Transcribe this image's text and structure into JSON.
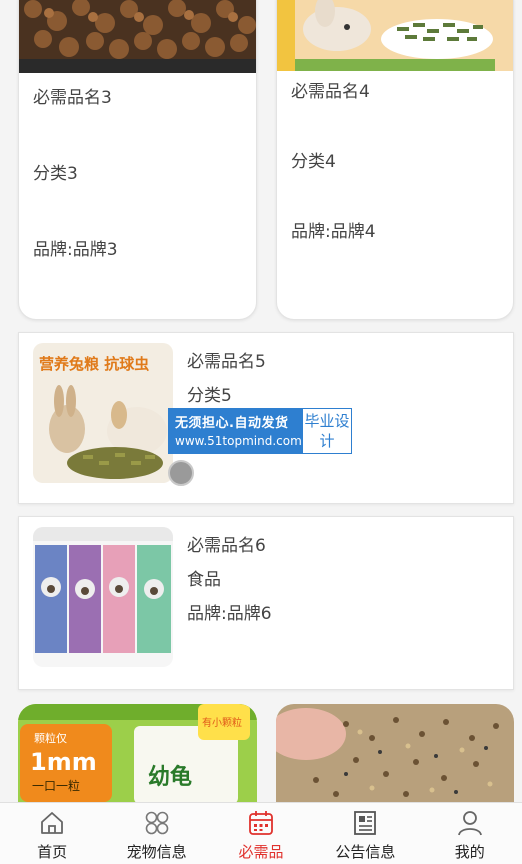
{
  "items": [
    {
      "name": "必需品名3",
      "category": "分类3",
      "brand": "品牌:品牌3"
    },
    {
      "name": "必需品名4",
      "category": "分类4",
      "brand": "品牌:品牌4"
    },
    {
      "name": "必需品名5",
      "category": "分类5"
    },
    {
      "name": "必需品名6",
      "category": "食品",
      "brand": "品牌:品牌6"
    }
  ],
  "image_text": {
    "rabbit_banner": "营养兔粮 抗球虫",
    "turtle_badge": "1mm",
    "turtle_badge_sub": "一口一粒",
    "turtle_badge_top": "颗粒仅",
    "turtle_pack": "幼龟",
    "turtle_corner": "有小颗粒"
  },
  "watermark": {
    "line1": "无须担心.自动发货",
    "line2": "www.51topmind.com",
    "side": "毕业设计"
  },
  "tabbar": {
    "tabs": [
      {
        "label": "首页",
        "icon": "home-icon"
      },
      {
        "label": "宠物信息",
        "icon": "grid-icon"
      },
      {
        "label": "必需品",
        "icon": "calendar-icon"
      },
      {
        "label": "公告信息",
        "icon": "news-icon"
      },
      {
        "label": "我的",
        "icon": "user-icon"
      }
    ],
    "active_index": 2
  },
  "colors": {
    "accent": "#e0322d",
    "watermark_blue": "#2e7fd0",
    "page_bg": "#f4f4f4"
  }
}
